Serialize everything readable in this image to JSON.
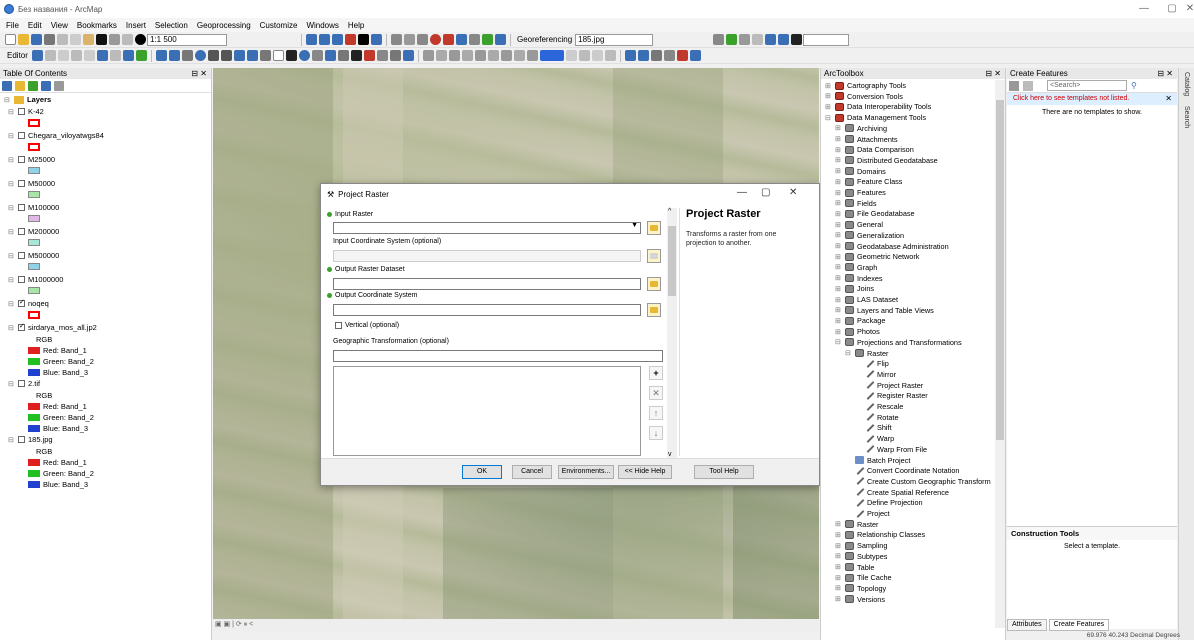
{
  "window": {
    "title": "Без названия - ArcMap"
  },
  "menu": [
    "File",
    "Edit",
    "View",
    "Bookmarks",
    "Insert",
    "Selection",
    "Geoprocessing",
    "Customize",
    "Windows",
    "Help"
  ],
  "toolbar": {
    "scale": "1:1 500",
    "georeferencing_label": "Georeferencing",
    "georef_layer": "185.jpg",
    "editor_label": "Editor"
  },
  "toc": {
    "header": "Table Of Contents",
    "root": "Layers",
    "layers": [
      {
        "name": "K-42",
        "checked": false,
        "symbol": "#ff0000"
      },
      {
        "name": "Chegara_viloyatwgs84",
        "checked": false,
        "symbol": "#ff0000"
      },
      {
        "name": "M25000",
        "checked": false,
        "symbol": "#8fd3e8"
      },
      {
        "name": "M50000",
        "checked": false,
        "symbol": "#a8e6a8"
      },
      {
        "name": "M100000",
        "checked": false,
        "symbol": "#e2b8e8"
      },
      {
        "name": "M200000",
        "checked": false,
        "symbol": "#a8e6d8"
      },
      {
        "name": "M500000",
        "checked": false,
        "symbol": "#8fd3e8"
      },
      {
        "name": "M1000000",
        "checked": false,
        "symbol": "#a8e6a8"
      },
      {
        "name": "noqeq",
        "checked": true,
        "symbol": "#ff0000"
      },
      {
        "name": "sirdarya_mos_all.jp2",
        "checked": true,
        "rgb": "RGB",
        "bands": [
          "Red:  Band_1",
          "Green: Band_2",
          "Blue:  Band_3"
        ]
      },
      {
        "name": "2.tif",
        "checked": false,
        "rgb": "RGB",
        "bands": [
          "Red:  Band_1",
          "Green: Band_2",
          "Blue:  Band_3"
        ]
      },
      {
        "name": "185.jpg",
        "checked": false,
        "rgb": "RGB",
        "bands": [
          "Red:  Band_1",
          "Green: Band_2",
          "Blue:  Band_3"
        ]
      }
    ]
  },
  "dialog": {
    "title": "Project Raster",
    "input_raster_label": "Input Raster",
    "input_cs_label": "Input Coordinate System (optional)",
    "output_dataset_label": "Output Raster Dataset",
    "output_cs_label": "Output Coordinate System",
    "vertical_label": "Vertical (optional)",
    "geo_transform_label": "Geographic Transformation (optional)",
    "help_title": "Project Raster",
    "help_text": "Transforms a raster from one projection to another.",
    "buttons": {
      "ok": "OK",
      "cancel": "Cancel",
      "environments": "Environments...",
      "hide_help": "<< Hide Help",
      "tool_help": "Tool Help"
    }
  },
  "toolbox": {
    "header": "ArcToolbox",
    "items": [
      {
        "label": "Cartography Tools",
        "kind": "box",
        "level": 0,
        "expand": "+"
      },
      {
        "label": "Conversion Tools",
        "kind": "box",
        "level": 0,
        "expand": "+"
      },
      {
        "label": "Data Interoperability Tools",
        "kind": "box",
        "level": 0,
        "expand": "+"
      },
      {
        "label": "Data Management Tools",
        "kind": "box",
        "level": 0,
        "expand": "-"
      },
      {
        "label": "Archiving",
        "kind": "set",
        "level": 1,
        "expand": "+"
      },
      {
        "label": "Attachments",
        "kind": "set",
        "level": 1,
        "expand": "+"
      },
      {
        "label": "Data Comparison",
        "kind": "set",
        "level": 1,
        "expand": "+"
      },
      {
        "label": "Distributed Geodatabase",
        "kind": "set",
        "level": 1,
        "expand": "+"
      },
      {
        "label": "Domains",
        "kind": "set",
        "level": 1,
        "expand": "+"
      },
      {
        "label": "Feature Class",
        "kind": "set",
        "level": 1,
        "expand": "+"
      },
      {
        "label": "Features",
        "kind": "set",
        "level": 1,
        "expand": "+"
      },
      {
        "label": "Fields",
        "kind": "set",
        "level": 1,
        "expand": "+"
      },
      {
        "label": "File Geodatabase",
        "kind": "set",
        "level": 1,
        "expand": "+"
      },
      {
        "label": "General",
        "kind": "set",
        "level": 1,
        "expand": "+"
      },
      {
        "label": "Generalization",
        "kind": "set",
        "level": 1,
        "expand": "+"
      },
      {
        "label": "Geodatabase Administration",
        "kind": "set",
        "level": 1,
        "expand": "+"
      },
      {
        "label": "Geometric Network",
        "kind": "set",
        "level": 1,
        "expand": "+"
      },
      {
        "label": "Graph",
        "kind": "set",
        "level": 1,
        "expand": "+"
      },
      {
        "label": "Indexes",
        "kind": "set",
        "level": 1,
        "expand": "+"
      },
      {
        "label": "Joins",
        "kind": "set",
        "level": 1,
        "expand": "+"
      },
      {
        "label": "LAS Dataset",
        "kind": "set",
        "level": 1,
        "expand": "+"
      },
      {
        "label": "Layers and Table Views",
        "kind": "set",
        "level": 1,
        "expand": "+"
      },
      {
        "label": "Package",
        "kind": "set",
        "level": 1,
        "expand": "+"
      },
      {
        "label": "Photos",
        "kind": "set",
        "level": 1,
        "expand": "+"
      },
      {
        "label": "Projections and Transformations",
        "kind": "set",
        "level": 1,
        "expand": "-"
      },
      {
        "label": "Raster",
        "kind": "set",
        "level": 2,
        "expand": "-"
      },
      {
        "label": "Flip",
        "kind": "tool",
        "level": 3,
        "expand": ""
      },
      {
        "label": "Mirror",
        "kind": "tool",
        "level": 3,
        "expand": ""
      },
      {
        "label": "Project Raster",
        "kind": "tool",
        "level": 3,
        "expand": ""
      },
      {
        "label": "Register Raster",
        "kind": "tool",
        "level": 3,
        "expand": ""
      },
      {
        "label": "Rescale",
        "kind": "tool",
        "level": 3,
        "expand": ""
      },
      {
        "label": "Rotate",
        "kind": "tool",
        "level": 3,
        "expand": ""
      },
      {
        "label": "Shift",
        "kind": "tool",
        "level": 3,
        "expand": ""
      },
      {
        "label": "Warp",
        "kind": "tool",
        "level": 3,
        "expand": ""
      },
      {
        "label": "Warp From File",
        "kind": "tool",
        "level": 3,
        "expand": ""
      },
      {
        "label": "Batch Project",
        "kind": "script",
        "level": 2,
        "expand": ""
      },
      {
        "label": "Convert Coordinate Notation",
        "kind": "tool",
        "level": 2,
        "expand": ""
      },
      {
        "label": "Create Custom Geographic Transform",
        "kind": "tool",
        "level": 2,
        "expand": ""
      },
      {
        "label": "Create Spatial Reference",
        "kind": "tool",
        "level": 2,
        "expand": ""
      },
      {
        "label": "Define Projection",
        "kind": "tool",
        "level": 2,
        "expand": ""
      },
      {
        "label": "Project",
        "kind": "tool",
        "level": 2,
        "expand": ""
      },
      {
        "label": "Raster",
        "kind": "set",
        "level": 1,
        "expand": "+"
      },
      {
        "label": "Relationship Classes",
        "kind": "set",
        "level": 1,
        "expand": "+"
      },
      {
        "label": "Sampling",
        "kind": "set",
        "level": 1,
        "expand": "+"
      },
      {
        "label": "Subtypes",
        "kind": "set",
        "level": 1,
        "expand": "+"
      },
      {
        "label": "Table",
        "kind": "set",
        "level": 1,
        "expand": "+"
      },
      {
        "label": "Tile Cache",
        "kind": "set",
        "level": 1,
        "expand": "+"
      },
      {
        "label": "Topology",
        "kind": "set",
        "level": 1,
        "expand": "+"
      },
      {
        "label": "Versions",
        "kind": "set",
        "level": 1,
        "expand": "+"
      }
    ]
  },
  "create_features": {
    "header": "Create Features",
    "search_placeholder": "<Search>",
    "link": "Click here to see templates not listed.",
    "empty": "There are no templates to show.",
    "construction_header": "Construction Tools",
    "construction_text": "Select a template.",
    "tabs": [
      "Attributes",
      "Create Features"
    ]
  },
  "side_tabs": [
    "Catalog",
    "Search"
  ],
  "status": {
    "coords": "69.976  40.243 Decimal Degrees"
  }
}
